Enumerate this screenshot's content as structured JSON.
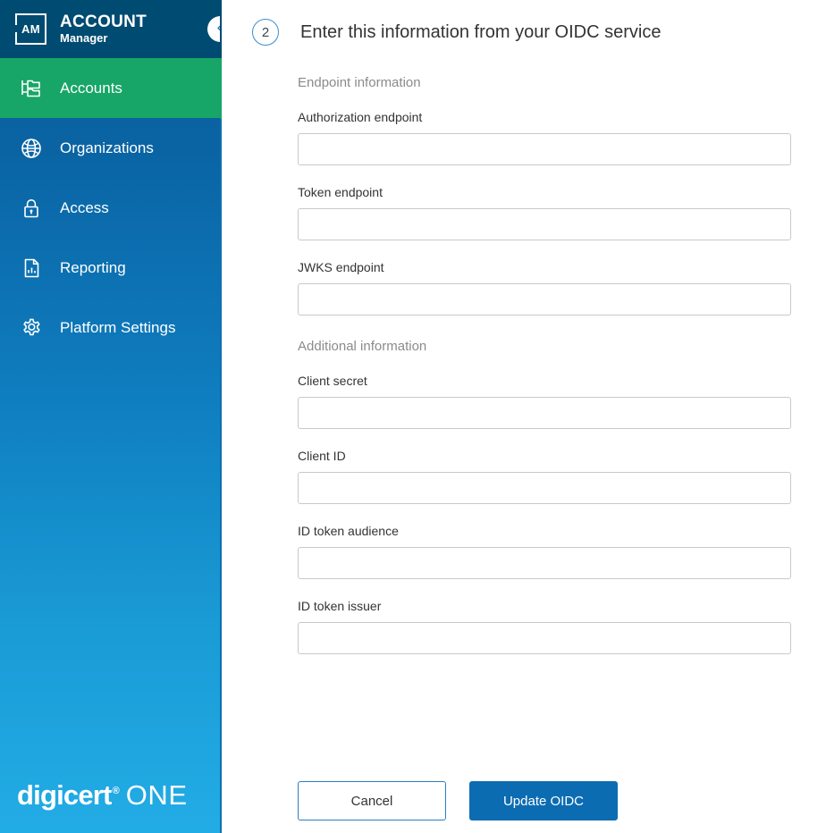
{
  "sidebar": {
    "logo": {
      "mark_text": "AM",
      "mark_icon": "account-manager-logo-icon",
      "title_line1": "ACCOUNT",
      "title_line2": "Manager"
    },
    "collapse_icon": "chevron-left-icon",
    "items": [
      {
        "label": "Accounts",
        "icon": "org-tree-icon",
        "active": true
      },
      {
        "label": "Organizations",
        "icon": "globe-icon",
        "active": false
      },
      {
        "label": "Access",
        "icon": "lock-icon",
        "active": false
      },
      {
        "label": "Reporting",
        "icon": "report-document-icon",
        "active": false
      },
      {
        "label": "Platform Settings",
        "icon": "gear-icon",
        "active": false
      }
    ],
    "brand": {
      "name": "digicert",
      "registered": "®",
      "product": "ONE"
    },
    "colors": {
      "header_bg": "#004b71",
      "gradient_top": "#0a5b96",
      "gradient_bottom": "#22ace5",
      "active_bg": "#17a667"
    }
  },
  "main": {
    "step": {
      "number": "2",
      "title": "Enter this information from your OIDC service"
    },
    "sections": [
      {
        "title": "Endpoint information",
        "fields": [
          {
            "label": "Authorization endpoint",
            "value": "",
            "placeholder": ""
          },
          {
            "label": "Token endpoint",
            "value": "",
            "placeholder": ""
          },
          {
            "label": "JWKS endpoint",
            "value": "",
            "placeholder": ""
          }
        ]
      },
      {
        "title": "Additional information",
        "fields": [
          {
            "label": "Client secret",
            "value": "",
            "placeholder": ""
          },
          {
            "label": "Client ID",
            "value": "",
            "placeholder": ""
          },
          {
            "label": "ID token audience",
            "value": "",
            "placeholder": ""
          },
          {
            "label": "ID token issuer",
            "value": "",
            "placeholder": ""
          }
        ]
      }
    ],
    "actions": {
      "cancel_label": "Cancel",
      "submit_label": "Update OIDC"
    },
    "colors": {
      "primary_button": "#0c6cb2",
      "step_ring": "#3e8ccc",
      "field_border": "#c9c9c9"
    }
  }
}
